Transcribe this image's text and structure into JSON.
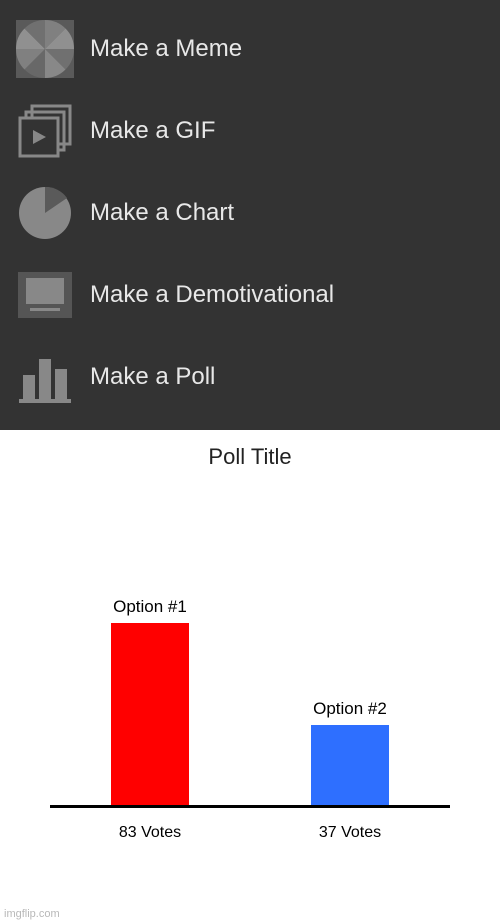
{
  "menu": {
    "items": [
      {
        "label": "Make a Meme",
        "icon": "meme-icon"
      },
      {
        "label": "Make a GIF",
        "icon": "gif-icon"
      },
      {
        "label": "Make a Chart",
        "icon": "chart-icon"
      },
      {
        "label": "Make a Demotivational",
        "icon": "demotivational-icon"
      },
      {
        "label": "Make a Poll",
        "icon": "poll-icon"
      }
    ]
  },
  "poll": {
    "title": "Poll Title"
  },
  "chart_data": {
    "type": "bar",
    "title": "Poll Title",
    "categories": [
      "Option #1",
      "Option #2"
    ],
    "values": [
      83,
      37
    ],
    "value_labels": [
      "83 Votes",
      "37 Votes"
    ],
    "series_colors": [
      "#ff0000",
      "#2e6fff"
    ],
    "ylim": [
      0,
      100
    ]
  },
  "watermark": "imgflip.com"
}
